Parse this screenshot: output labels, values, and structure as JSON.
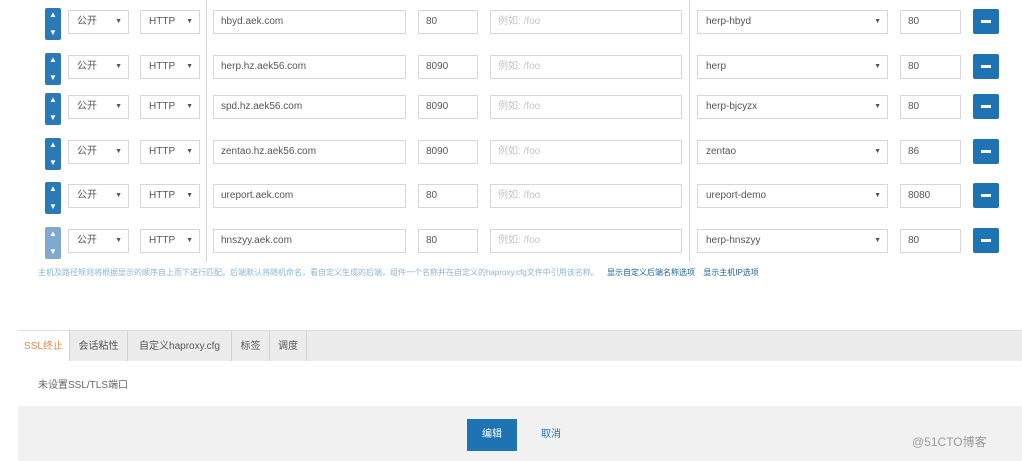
{
  "rows": [
    {
      "access": "公开",
      "protocol": "HTTP",
      "host": "hbyd.aek.com",
      "port": "80",
      "path_placeholder": "例如: /foo",
      "backend": "herp-hbyd",
      "backend_port": "80"
    },
    {
      "access": "公开",
      "protocol": "HTTP",
      "host": "herp.hz.aek56.com",
      "port": "8090",
      "path_placeholder": "例如: /foo",
      "backend": "herp",
      "backend_port": "80"
    },
    {
      "access": "公开",
      "protocol": "HTTP",
      "host": "spd.hz.aek56.com",
      "port": "8090",
      "path_placeholder": "例如: /foo",
      "backend": "herp-bjcyzx",
      "backend_port": "80"
    },
    {
      "access": "公开",
      "protocol": "HTTP",
      "host": "zentao.hz.aek56.com",
      "port": "8090",
      "path_placeholder": "例如: /foo",
      "backend": "zentao",
      "backend_port": "86"
    },
    {
      "access": "公开",
      "protocol": "HTTP",
      "host": "ureport.aek.com",
      "port": "80",
      "path_placeholder": "例如: /foo",
      "backend": "ureport-demo",
      "backend_port": "8080"
    },
    {
      "access": "公开",
      "protocol": "HTTP",
      "host": "hnszyy.aek.com",
      "port": "80",
      "path_placeholder": "例如: /foo",
      "backend": "herp-hnszyy",
      "backend_port": "80"
    }
  ],
  "hint": {
    "text": "主机及路径规则将根据显示的顺序自上而下进行匹配。后端默认将随机命名，看自定义生成的后端，组件一个名称并在自定义的haproxy.cfg文件中引用该名称。",
    "link1": "显示自定义后端名称选项",
    "link2": "显示主机IP选项"
  },
  "tabs": [
    {
      "label": "SSL终止",
      "active": true
    },
    {
      "label": "会话粘性",
      "active": false
    },
    {
      "label": "自定义haproxy.cfg",
      "active": false
    },
    {
      "label": "标签",
      "active": false
    },
    {
      "label": "调度",
      "active": false
    }
  ],
  "tab_body": {
    "message": "未设置SSL/TLS端口"
  },
  "footer": {
    "edit_label": "编辑",
    "cancel_label": "取消"
  },
  "watermark": "@51CTO博客",
  "icons": {
    "up": "chevron-up-icon",
    "down": "chevron-down-icon",
    "remove": "minus-icon"
  },
  "colors": {
    "accent": "#1e73b3",
    "tab_active_text": "#e7894a",
    "hint_text": "#8ab5d6"
  }
}
